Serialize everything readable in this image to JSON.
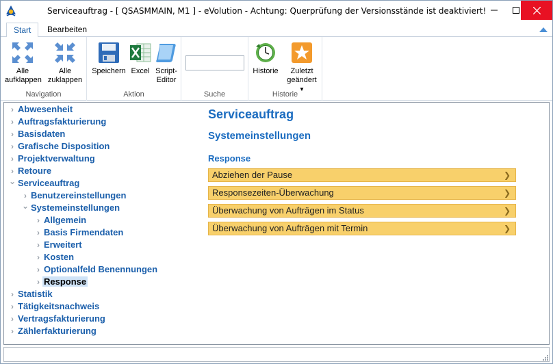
{
  "window": {
    "title": "Serviceauftrag - [ QSASMMAIN, M1 ]  -  eVolution - Achtung: Querprüfung der Versionsstände ist deaktiviert!"
  },
  "ribbon": {
    "tabs": [
      {
        "label": "Start",
        "active": true
      },
      {
        "label": "Bearbeiten",
        "active": false
      }
    ],
    "groups": {
      "navigation": {
        "label": "Navigation",
        "buttons": [
          {
            "line1": "Alle",
            "line2": "aufklappen",
            "icon": "expand-all-icon"
          },
          {
            "line1": "Alle",
            "line2": "zuklappen",
            "icon": "collapse-all-icon"
          }
        ]
      },
      "aktion": {
        "label": "Aktion",
        "buttons": [
          {
            "line1": "Speichern",
            "line2": "",
            "icon": "save-icon"
          },
          {
            "line1": "Excel",
            "line2": "",
            "icon": "excel-icon"
          },
          {
            "line1": "Script-",
            "line2": "Editor",
            "icon": "script-editor-icon"
          }
        ]
      },
      "suche": {
        "label": "Suche",
        "value": ""
      },
      "historie": {
        "label": "Historie",
        "buttons": [
          {
            "line1": "Historie",
            "line2": "",
            "icon": "history-clock-icon"
          },
          {
            "line1": "Zuletzt",
            "line2": "geändert",
            "icon": "star-icon"
          }
        ]
      }
    }
  },
  "tree": {
    "items": [
      {
        "label": "Abwesenheit",
        "level": 0,
        "expanded": false
      },
      {
        "label": "Auftragsfakturierung",
        "level": 0,
        "expanded": false
      },
      {
        "label": "Basisdaten",
        "level": 0,
        "expanded": false
      },
      {
        "label": "Grafische Disposition",
        "level": 0,
        "expanded": false
      },
      {
        "label": "Projektverwaltung",
        "level": 0,
        "expanded": false
      },
      {
        "label": "Retoure",
        "level": 0,
        "expanded": false
      },
      {
        "label": "Serviceauftrag",
        "level": 0,
        "expanded": true
      },
      {
        "label": "Benutzereinstellungen",
        "level": 1,
        "expanded": false
      },
      {
        "label": "Systemeinstellungen",
        "level": 1,
        "expanded": true
      },
      {
        "label": "Allgemein",
        "level": 2,
        "expanded": false
      },
      {
        "label": "Basis Firmendaten",
        "level": 2,
        "expanded": false
      },
      {
        "label": "Erweitert",
        "level": 2,
        "expanded": false
      },
      {
        "label": "Kosten",
        "level": 2,
        "expanded": false
      },
      {
        "label": "Optionalfeld Benennungen",
        "level": 2,
        "expanded": false
      },
      {
        "label": "Response",
        "level": 2,
        "expanded": false,
        "selected": true
      },
      {
        "label": "Statistik",
        "level": 0,
        "expanded": false
      },
      {
        "label": "Tätigkeitsnachweis",
        "level": 0,
        "expanded": false
      },
      {
        "label": "Vertragsfakturierung",
        "level": 0,
        "expanded": false
      },
      {
        "label": "Zählerfakturierung",
        "level": 0,
        "expanded": false
      }
    ]
  },
  "main": {
    "title": "Serviceauftrag",
    "subtitle": "Systemeinstellungen",
    "section": "Response",
    "bars": [
      "Abziehen der Pause",
      "Responsezeiten-Überwachung",
      "Überwachung von Aufträgen im Status",
      "Überwachung von Aufträgen mit Termin"
    ],
    "bar_color": "#f8d06b"
  },
  "colors": {
    "link_blue": "#1b5fab",
    "heading_blue": "#1b6cc0",
    "close_red": "#e81123"
  }
}
